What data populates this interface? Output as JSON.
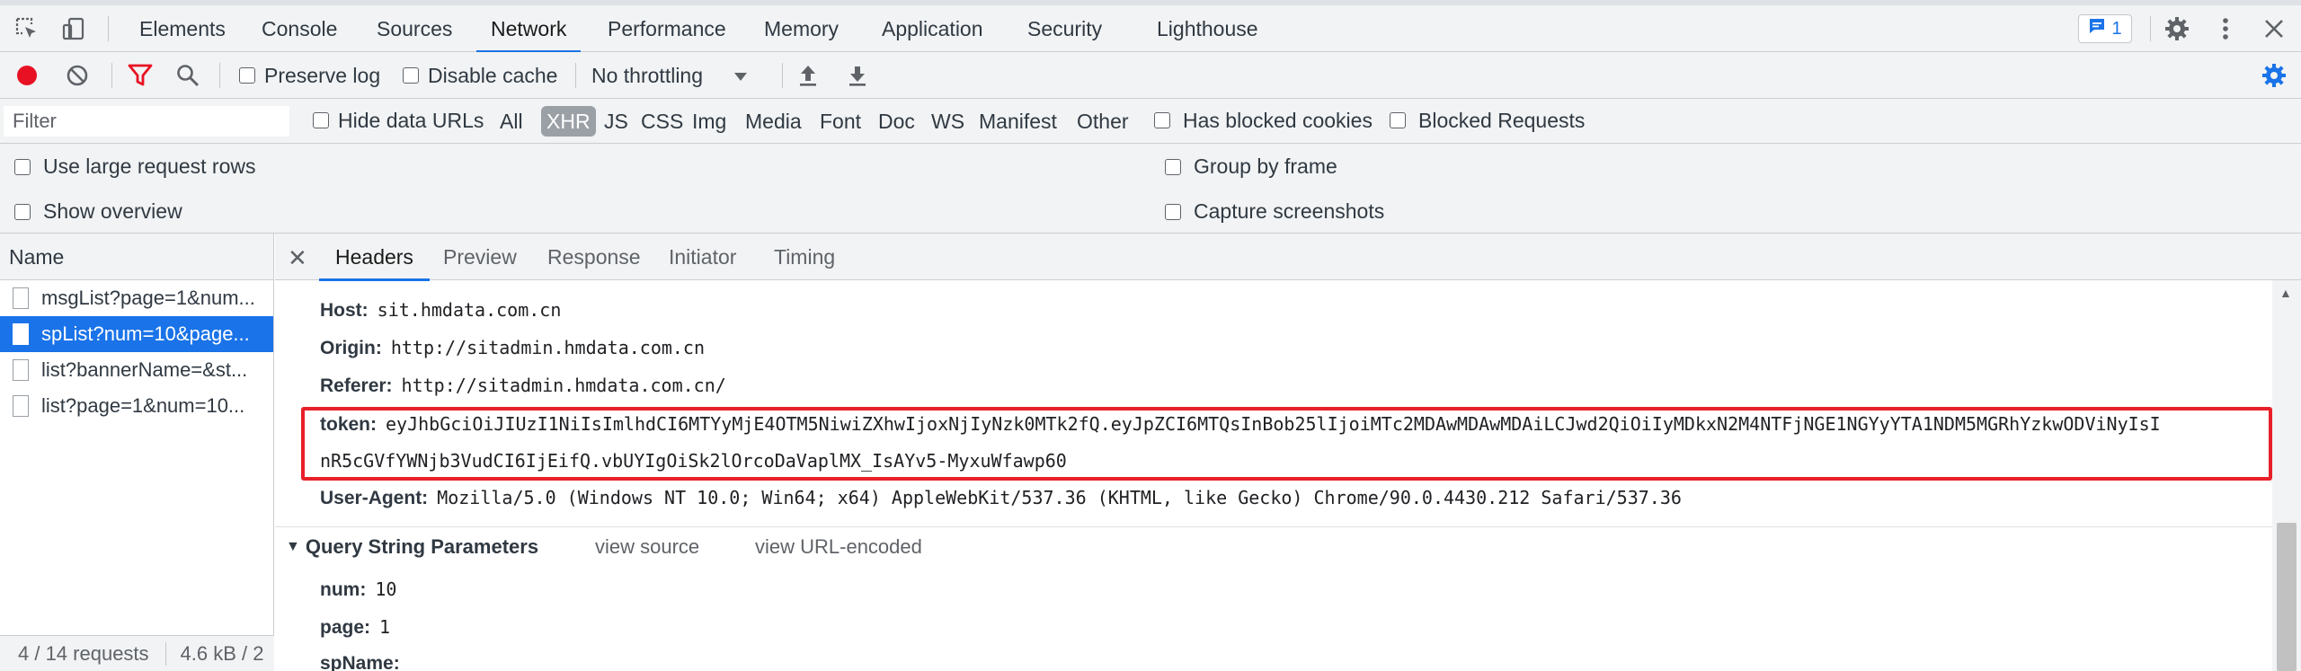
{
  "devtools": {
    "main_tabs": [
      "Elements",
      "Console",
      "Sources",
      "Network",
      "Performance",
      "Memory",
      "Application",
      "Security",
      "Lighthouse"
    ],
    "active_tab": "Network",
    "issues_count": "1"
  },
  "toolbar": {
    "preserve_log": "Preserve log",
    "disable_cache": "Disable cache",
    "throttling": "No throttling"
  },
  "filter": {
    "placeholder": "Filter",
    "hide_data_urls": "Hide data URLs",
    "types": [
      "All",
      "XHR",
      "JS",
      "CSS",
      "Img",
      "Media",
      "Font",
      "Doc",
      "WS",
      "Manifest",
      "Other"
    ],
    "selected_type": "XHR",
    "has_blocked_cookies": "Has blocked cookies",
    "blocked_requests": "Blocked Requests"
  },
  "options": {
    "large_rows": "Use large request rows",
    "show_overview": "Show overview",
    "group_by_frame": "Group by frame",
    "capture_screenshots": "Capture screenshots"
  },
  "requests": {
    "header": "Name",
    "items": [
      "msgList?page=1&num...",
      "spList?num=10&page...",
      "list?bannerName=&st...",
      "list?page=1&num=10..."
    ],
    "selected_index": 1,
    "status_count": "4 / 14 requests",
    "status_size": "4.6 kB / 2"
  },
  "details": {
    "tabs": [
      "Headers",
      "Preview",
      "Response",
      "Initiator",
      "Timing"
    ],
    "active_tab": "Headers",
    "headers": [
      {
        "key": "Host:",
        "value": "sit.hmdata.com.cn"
      },
      {
        "key": "Origin:",
        "value": "http://sitadmin.hmdata.com.cn"
      },
      {
        "key": "Referer:",
        "value": "http://sitadmin.hmdata.com.cn/"
      }
    ],
    "token_key": "token:",
    "token_line1": "eyJhbGciOiJIUzI1NiIsImlhdCI6MTYyMjE4OTM5NiwiZXhwIjoxNjIyNzk0MTk2fQ.eyJpZCI6MTQsInBob25lIjoiMTc2MDAwMDAwMDAiLCJwd2QiOiIyMDkxN2M4NTFjNGE1NGYyYTA1NDM5MGRhYzkwODViNyIsI",
    "token_line2": "nR5cGVfYWNjb3VudCI6IjEifQ.vbUYIgOiSk2lOrcoDaVaplMX_IsAYv5-MyxuWfawp60",
    "user_agent_key": "User-Agent:",
    "user_agent_value": "Mozilla/5.0 (Windows NT 10.0; Win64; x64) AppleWebKit/537.36 (KHTML, like Gecko) Chrome/90.0.4430.212 Safari/537.36",
    "query_title": "Query String Parameters",
    "view_source": "view source",
    "view_url_encoded": "view URL-encoded",
    "params": [
      {
        "key": "num:",
        "value": "10"
      },
      {
        "key": "page:",
        "value": "1"
      },
      {
        "key": "spName:",
        "value": ""
      }
    ]
  },
  "colors": {
    "accent": "#1a73e8",
    "record": "#e81123",
    "highlight_box": "#e8202a"
  }
}
